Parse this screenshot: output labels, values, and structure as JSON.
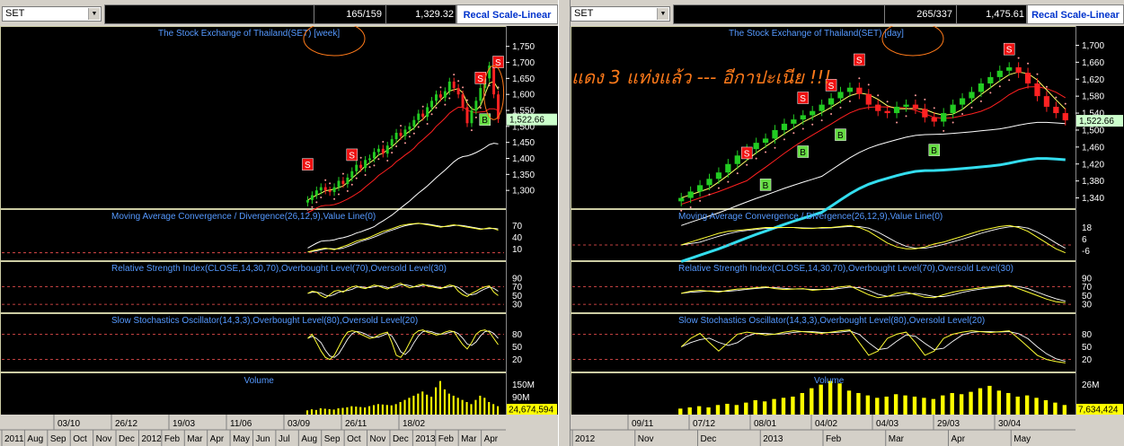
{
  "left": {
    "symbol": "SET",
    "bar_counter": "165/159",
    "last_value": "1,329.32",
    "recal_label": "Recal Scale-Linear",
    "price_title": "The Stock Exchange of Thailand(SET) [week]",
    "last_price_label": "1,522.66",
    "price_ticks": [
      "1,750",
      "1,700",
      "1,650",
      "1,600",
      "1,550",
      "1,500",
      "1,450",
      "1,400",
      "1,350",
      "1,300"
    ],
    "macd_title": "Moving Average Convergence / Divergence(26,12,9),Value Line(0)",
    "macd_ticks": [
      "70",
      "40",
      "10"
    ],
    "rsi_title": "Relative Strength Index(CLOSE,14,30,70),Overbought Level(70),Oversold Level(30)",
    "rsi_ticks": [
      "90",
      "70",
      "50",
      "30"
    ],
    "sto_title": "Slow Stochastics Oscillator(14,3,3),Overbought Level(80),Oversold Level(20)",
    "sto_ticks": [
      "80",
      "50",
      "20"
    ],
    "vol_title": "Volume",
    "vol_ticks": [
      "150M",
      "90M"
    ],
    "vol_last": "24,674,594",
    "date_row1": [
      "03/10",
      "26/12",
      "19/03",
      "11/06",
      "03/09",
      "26/11",
      "18/02"
    ],
    "date_row2": [
      "2011",
      "Aug",
      "Sep",
      "Oct",
      "Nov",
      "Dec",
      "2012",
      "Feb",
      "Mar",
      "Apr",
      "May",
      "Jun",
      "Jul",
      "Aug",
      "Sep",
      "Oct",
      "Nov",
      "Dec",
      "2013",
      "Feb",
      "Mar",
      "Apr"
    ]
  },
  "right": {
    "symbol": "SET",
    "bar_counter": "265/337",
    "last_value": "1,475.61",
    "recal_label": "Recal Scale-Linear",
    "price_title": "The Stock Exchange of Thailand(SET) [day]",
    "last_price_label": "1,522.66",
    "price_ticks": [
      "1,700",
      "1,660",
      "1,620",
      "1,580",
      "1,540",
      "1,500",
      "1,460",
      "1,420",
      "1,380",
      "1,340"
    ],
    "macd_title": "Moving Average Convergence / Divergence(26,12,9),Value Line(0)",
    "macd_ticks": [
      "18",
      "6",
      "-6"
    ],
    "rsi_title": "Relative Strength Index(CLOSE,14,30,70),Overbought Level(70),Oversold Level(30)",
    "rsi_ticks": [
      "90",
      "70",
      "50",
      "30"
    ],
    "sto_title": "Slow Stochastics Oscillator(14,3,3),Overbought Level(80),Oversold Level(20)",
    "sto_ticks": [
      "80",
      "50",
      "20"
    ],
    "vol_title": "Volume",
    "vol_ticks": [
      "26M"
    ],
    "vol_last": "7,634,424",
    "date_row1": [
      "09/11",
      "07/12",
      "08/01",
      "04/02",
      "04/03",
      "29/03",
      "30/04"
    ],
    "date_row2": [
      "2012",
      "Nov",
      "Dec",
      "2013",
      "Feb",
      "Mar",
      "Apr",
      "May"
    ]
  },
  "annotation": "แดง 3 แท่งแล้ว --- อีกาปะเนีย !!!",
  "signal_labels": {
    "sell": "S",
    "buy": "B"
  },
  "colors": {
    "up": "#22cc22",
    "down": "#ff2222",
    "ma_fast": "#ffff66",
    "ma_slow": "#ffffff",
    "ma_red": "#ff2020",
    "sar": "#ff9999",
    "cyan": "#33ddee",
    "title": "#5599ff",
    "macd": "#ffff33",
    "signal": "#ffffff",
    "guide": "#ff5555",
    "volume": "#ffff00",
    "highlight": "#ff7a1a",
    "panel_border": "#ffffcc"
  },
  "chart_data": [
    {
      "type": "candlestick",
      "panel": "left-weekly",
      "title": "The Stock Exchange of Thailand(SET) [week]",
      "ylim": [
        1250,
        1780
      ],
      "close": [
        1270,
        1285,
        1300,
        1310,
        1300,
        1295,
        1310,
        1330,
        1320,
        1340,
        1360,
        1380,
        1370,
        1395,
        1400,
        1420,
        1430,
        1415,
        1440,
        1460,
        1480,
        1470,
        1490,
        1500,
        1520,
        1540,
        1530,
        1560,
        1580,
        1600,
        1590,
        1610,
        1640,
        1620,
        1600,
        1560,
        1510,
        1550,
        1580,
        1620,
        1650,
        1690,
        1600,
        1523
      ],
      "sell_points": [
        [
          0,
          1380
        ],
        [
          10,
          1410
        ],
        [
          39,
          1650
        ],
        [
          43,
          1700
        ]
      ],
      "buy_points": [
        [
          40,
          1520
        ]
      ],
      "indicators": {
        "macd_range": [
          -10,
          80
        ],
        "macd": [
          2,
          5,
          8,
          10,
          12,
          10,
          8,
          12,
          16,
          20,
          25,
          30,
          33,
          36,
          40,
          45,
          50,
          55,
          58,
          62,
          66,
          70,
          72,
          74,
          75,
          76,
          74,
          72,
          70,
          68,
          66,
          68,
          70,
          72,
          70,
          68,
          66,
          64,
          62,
          60,
          62,
          64,
          62,
          58
        ],
        "rsi": [
          55,
          60,
          58,
          50,
          45,
          52,
          60,
          62,
          58,
          65,
          70,
          72,
          68,
          66,
          70,
          74,
          72,
          68,
          65,
          70,
          75,
          78,
          72,
          68,
          70,
          74,
          76,
          72,
          70,
          68,
          66,
          70,
          74,
          72,
          60,
          52,
          48,
          55,
          60,
          66,
          70,
          72,
          58,
          50
        ],
        "stoch": [
          70,
          80,
          60,
          40,
          25,
          20,
          30,
          50,
          70,
          85,
          88,
          86,
          80,
          75,
          70,
          72,
          78,
          82,
          85,
          60,
          30,
          25,
          40,
          60,
          80,
          88,
          90,
          85,
          82,
          78,
          80,
          85,
          88,
          86,
          70,
          55,
          45,
          60,
          80,
          88,
          90,
          85,
          70,
          55
        ]
      },
      "volume": [
        20,
        25,
        22,
        30,
        28,
        26,
        24,
        30,
        32,
        35,
        40,
        38,
        36,
        34,
        40,
        45,
        50,
        48,
        46,
        44,
        50,
        60,
        70,
        80,
        90,
        100,
        110,
        95,
        85,
        130,
        160,
        120,
        100,
        90,
        80,
        70,
        60,
        50,
        70,
        90,
        80,
        60,
        50,
        40
      ]
    },
    {
      "type": "candlestick",
      "panel": "right-daily",
      "title": "The Stock Exchange of Thailand(SET) [day]",
      "ylim": [
        1320,
        1720
      ],
      "close": [
        1340,
        1355,
        1370,
        1385,
        1400,
        1420,
        1440,
        1455,
        1470,
        1480,
        1500,
        1515,
        1525,
        1535,
        1545,
        1560,
        1575,
        1590,
        1600,
        1585,
        1560,
        1545,
        1540,
        1555,
        1560,
        1550,
        1530,
        1520,
        1540,
        1560,
        1575,
        1590,
        1610,
        1625,
        1640,
        1648,
        1635,
        1610,
        1580,
        1555,
        1540,
        1523
      ],
      "sell_points": [
        [
          7,
          1445
        ],
        [
          13,
          1575
        ],
        [
          16,
          1605
        ],
        [
          19,
          1665
        ],
        [
          35,
          1690
        ]
      ],
      "buy_points": [
        [
          9,
          1370
        ],
        [
          13,
          1448
        ],
        [
          17,
          1488
        ],
        [
          27,
          1452
        ]
      ],
      "indicators": {
        "macd_range": [
          -12,
          24
        ],
        "macd": [
          0,
          3,
          6,
          9,
          12,
          14,
          15,
          16,
          17,
          18,
          18,
          18,
          18,
          17,
          17,
          18,
          18,
          19,
          20,
          18,
          14,
          8,
          2,
          -2,
          -4,
          -4,
          -2,
          1,
          3,
          6,
          9,
          12,
          15,
          17,
          19,
          20,
          18,
          14,
          8,
          2,
          -4,
          -8
        ],
        "rsi": [
          55,
          60,
          62,
          60,
          58,
          62,
          65,
          66,
          68,
          70,
          66,
          64,
          65,
          66,
          62,
          64,
          66,
          70,
          72,
          62,
          52,
          45,
          48,
          55,
          58,
          52,
          46,
          45,
          52,
          58,
          62,
          65,
          68,
          70,
          72,
          74,
          66,
          58,
          50,
          42,
          36,
          34
        ],
        "stoch": [
          50,
          70,
          82,
          60,
          40,
          60,
          80,
          85,
          82,
          78,
          80,
          85,
          88,
          86,
          84,
          82,
          85,
          88,
          90,
          60,
          30,
          40,
          70,
          80,
          85,
          60,
          30,
          40,
          70,
          80,
          85,
          88,
          86,
          84,
          86,
          88,
          70,
          50,
          30,
          20,
          15,
          12
        ]
      },
      "volume": [
        5,
        6,
        7,
        6,
        8,
        9,
        8,
        10,
        12,
        11,
        13,
        14,
        15,
        18,
        22,
        25,
        28,
        26,
        20,
        18,
        16,
        14,
        15,
        17,
        16,
        15,
        14,
        13,
        16,
        18,
        17,
        19,
        22,
        24,
        20,
        18,
        15,
        16,
        14,
        12,
        10,
        8
      ]
    }
  ]
}
